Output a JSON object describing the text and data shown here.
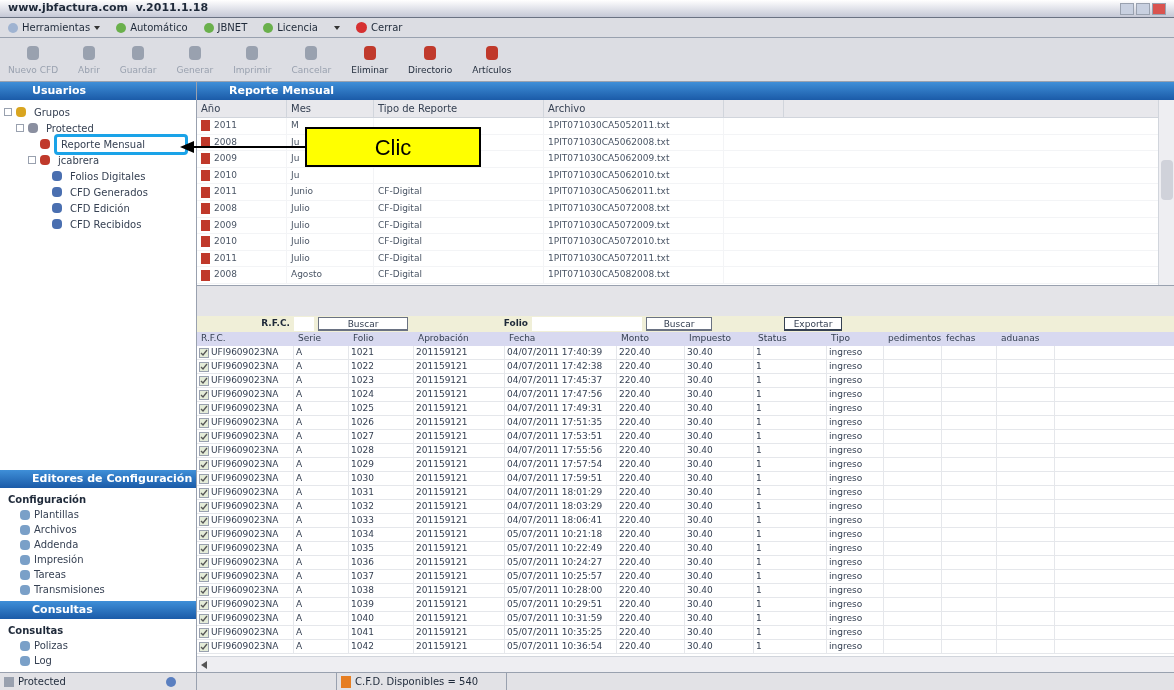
{
  "window": {
    "title": "www.jbfactura.com  v.2011.1.18"
  },
  "menu": [
    {
      "label": "Herramientas",
      "kind": "dropdown"
    },
    {
      "label": "Automático",
      "kind": "item"
    },
    {
      "label": "JBNET",
      "kind": "item"
    },
    {
      "label": "Licencia",
      "kind": "item"
    },
    {
      "kind": "caret"
    },
    {
      "label": "Cerrar",
      "kind": "close"
    }
  ],
  "toolbar": [
    {
      "label": "Nuevo CFD",
      "disabled": true
    },
    {
      "label": "Abrir",
      "disabled": true
    },
    {
      "label": "Guardar",
      "disabled": true
    },
    {
      "label": "Generar",
      "disabled": true
    },
    {
      "label": "Imprimir",
      "disabled": true
    },
    {
      "label": "Cancelar",
      "disabled": true
    },
    {
      "label": "Eliminar",
      "disabled": false
    },
    {
      "label": "Directorio",
      "disabled": false
    },
    {
      "label": "Artículos",
      "disabled": false
    }
  ],
  "sidebar": {
    "title": "Usuarios",
    "tree": [
      {
        "label": "Grupos",
        "selected": false,
        "children": [
          {
            "label": "Protected",
            "selected": false,
            "children": [
              {
                "label": "Reporte Mensual",
                "selected": true
              },
              {
                "label": "jcabrera",
                "selected": false,
                "children": [
                  {
                    "label": "Folios Digitales",
                    "selected": false
                  },
                  {
                    "label": "CFD Generados",
                    "selected": false
                  },
                  {
                    "label": "CFD Edición",
                    "selected": false
                  },
                  {
                    "label": "CFD Recibidos",
                    "selected": false
                  }
                ]
              }
            ]
          }
        ]
      }
    ],
    "panels": [
      {
        "title": "Editores de Configuración",
        "root": "Configuración",
        "items": [
          "Plantillas",
          "Archivos",
          "Addenda",
          "Impresión",
          "Tareas",
          "Transmisiones"
        ]
      },
      {
        "title": "Consultas",
        "root": "Consultas",
        "items": [
          "Polizas",
          "Log"
        ]
      }
    ]
  },
  "report": {
    "title": "Reporte Mensual",
    "columns": [
      "Año",
      "Mes",
      "Tipo de Reporte",
      "Archivo"
    ],
    "rows": [
      [
        "2011",
        "M",
        "",
        "1PIT071030CA5052011.txt"
      ],
      [
        "2008",
        "Ju",
        "",
        "1PIT071030CA5062008.txt"
      ],
      [
        "2009",
        "Ju",
        "",
        "1PIT071030CA5062009.txt"
      ],
      [
        "2010",
        "Ju",
        "",
        "1PIT071030CA5062010.txt"
      ],
      [
        "2011",
        "Junio",
        "CF-Digital",
        "1PIT071030CA5062011.txt"
      ],
      [
        "2008",
        "Julio",
        "CF-Digital",
        "1PIT071030CA5072008.txt"
      ],
      [
        "2009",
        "Julio",
        "CF-Digital",
        "1PIT071030CA5072009.txt"
      ],
      [
        "2010",
        "Julio",
        "CF-Digital",
        "1PIT071030CA5072010.txt"
      ],
      [
        "2011",
        "Julio",
        "CF-Digital",
        "1PIT071030CA5072011.txt"
      ],
      [
        "2008",
        "Agosto",
        "CF-Digital",
        "1PIT071030CA5082008.txt"
      ]
    ]
  },
  "filters": {
    "rfc_label": "R.F.C.",
    "folio_label": "Folio",
    "search_buttons": [
      "Buscar",
      "Buscar"
    ],
    "export_button": "Exportar"
  },
  "grid": {
    "columns": [
      "R.F.C.",
      "Serie",
      "Folio",
      "Aprobación",
      "Fecha",
      "Monto",
      "Impuesto",
      "Status",
      "Tipo",
      "pedimentos",
      "fechas",
      "aduanas"
    ],
    "rows": [
      {
        "checked": true,
        "cells": [
          "UFI9609023NA",
          "A",
          "1021",
          "201159121",
          "04/07/2011 17:40:39",
          "220.40",
          "30.40",
          "1",
          "ingreso"
        ]
      },
      {
        "checked": true,
        "cells": [
          "UFI9609023NA",
          "A",
          "1022",
          "201159121",
          "04/07/2011 17:42:38",
          "220.40",
          "30.40",
          "1",
          "ingreso"
        ]
      },
      {
        "checked": true,
        "cells": [
          "UFI9609023NA",
          "A",
          "1023",
          "201159121",
          "04/07/2011 17:45:37",
          "220.40",
          "30.40",
          "1",
          "ingreso"
        ]
      },
      {
        "checked": true,
        "cells": [
          "UFI9609023NA",
          "A",
          "1024",
          "201159121",
          "04/07/2011 17:47:56",
          "220.40",
          "30.40",
          "1",
          "ingreso"
        ]
      },
      {
        "checked": true,
        "cells": [
          "UFI9609023NA",
          "A",
          "1025",
          "201159121",
          "04/07/2011 17:49:31",
          "220.40",
          "30.40",
          "1",
          "ingreso"
        ]
      },
      {
        "checked": true,
        "cells": [
          "UFI9609023NA",
          "A",
          "1026",
          "201159121",
          "04/07/2011 17:51:35",
          "220.40",
          "30.40",
          "1",
          "ingreso"
        ]
      },
      {
        "checked": true,
        "cells": [
          "UFI9609023NA",
          "A",
          "1027",
          "201159121",
          "04/07/2011 17:53:51",
          "220.40",
          "30.40",
          "1",
          "ingreso"
        ]
      },
      {
        "checked": true,
        "cells": [
          "UFI9609023NA",
          "A",
          "1028",
          "201159121",
          "04/07/2011 17:55:56",
          "220.40",
          "30.40",
          "1",
          "ingreso"
        ]
      },
      {
        "checked": true,
        "cells": [
          "UFI9609023NA",
          "A",
          "1029",
          "201159121",
          "04/07/2011 17:57:54",
          "220.40",
          "30.40",
          "1",
          "ingreso"
        ]
      },
      {
        "checked": true,
        "cells": [
          "UFI9609023NA",
          "A",
          "1030",
          "201159121",
          "04/07/2011 17:59:51",
          "220.40",
          "30.40",
          "1",
          "ingreso"
        ]
      },
      {
        "checked": true,
        "cells": [
          "UFI9609023NA",
          "A",
          "1031",
          "201159121",
          "04/07/2011 18:01:29",
          "220.40",
          "30.40",
          "1",
          "ingreso"
        ]
      },
      {
        "checked": true,
        "cells": [
          "UFI9609023NA",
          "A",
          "1032",
          "201159121",
          "04/07/2011 18:03:29",
          "220.40",
          "30.40",
          "1",
          "ingreso"
        ]
      },
      {
        "checked": true,
        "cells": [
          "UFI9609023NA",
          "A",
          "1033",
          "201159121",
          "04/07/2011 18:06:41",
          "220.40",
          "30.40",
          "1",
          "ingreso"
        ]
      },
      {
        "checked": true,
        "cells": [
          "UFI9609023NA",
          "A",
          "1034",
          "201159121",
          "05/07/2011 10:21:18",
          "220.40",
          "30.40",
          "1",
          "ingreso"
        ]
      },
      {
        "checked": true,
        "cells": [
          "UFI9609023NA",
          "A",
          "1035",
          "201159121",
          "05/07/2011 10:22:49",
          "220.40",
          "30.40",
          "1",
          "ingreso"
        ]
      },
      {
        "checked": true,
        "cells": [
          "UFI9609023NA",
          "A",
          "1036",
          "201159121",
          "05/07/2011 10:24:27",
          "220.40",
          "30.40",
          "1",
          "ingreso"
        ]
      },
      {
        "checked": true,
        "cells": [
          "UFI9609023NA",
          "A",
          "1037",
          "201159121",
          "05/07/2011 10:25:57",
          "220.40",
          "30.40",
          "1",
          "ingreso"
        ]
      },
      {
        "checked": true,
        "cells": [
          "UFI9609023NA",
          "A",
          "1038",
          "201159121",
          "05/07/2011 10:28:00",
          "220.40",
          "30.40",
          "1",
          "ingreso"
        ]
      },
      {
        "checked": true,
        "cells": [
          "UFI9609023NA",
          "A",
          "1039",
          "201159121",
          "05/07/2011 10:29:51",
          "220.40",
          "30.40",
          "1",
          "ingreso"
        ]
      },
      {
        "checked": true,
        "cells": [
          "UFI9609023NA",
          "A",
          "1040",
          "201159121",
          "05/07/2011 10:31:59",
          "220.40",
          "30.40",
          "1",
          "ingreso"
        ]
      },
      {
        "checked": true,
        "cells": [
          "UFI9609023NA",
          "A",
          "1041",
          "201159121",
          "05/07/2011 10:35:25",
          "220.40",
          "30.40",
          "1",
          "ingreso"
        ]
      },
      {
        "checked": true,
        "cells": [
          "UFI9609023NA",
          "A",
          "1042",
          "201159121",
          "05/07/2011 10:36:54",
          "220.40",
          "30.40",
          "1",
          "ingreso"
        ]
      }
    ]
  },
  "status_bar": {
    "user": "Protected",
    "available": "C.F.D. Disponibles = 540"
  },
  "callout": {
    "label": "Clic"
  }
}
